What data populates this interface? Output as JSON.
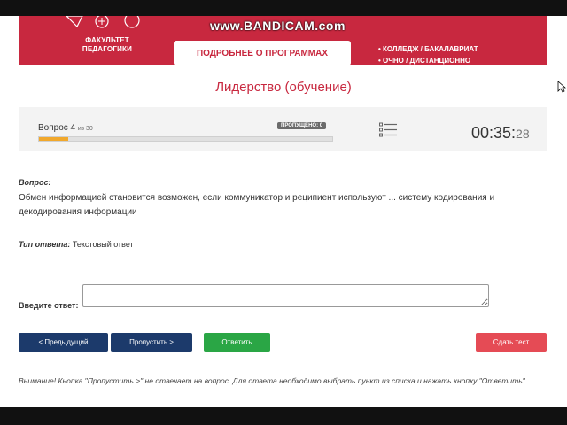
{
  "watermark": "www.BANDICAM.com",
  "banner": {
    "faculty_line1": "ФАКУЛЬТЕТ",
    "faculty_line2": "ПЕДАГОГИКИ",
    "programs_button": "ПОДРОБНЕЕ О ПРОГРАММАХ",
    "feature1": "• КОЛЛЕДЖ / БАКАЛАВРИАТ",
    "feature2": "• ОЧНО / ДИСТАНЦИОННО"
  },
  "page_title": "Лидерство (обучение)",
  "progress": {
    "question_label": "Вопрос 4",
    "of_label": "из 30",
    "skipped_badge": "ПРОПУЩЕНО: 0",
    "fraction": 0.1,
    "colors": {
      "fill": "#f1a82c",
      "track": "#e0e0e0"
    }
  },
  "timer": {
    "main": "00:35:",
    "seconds": "28"
  },
  "question": {
    "label": "Вопрос:",
    "text": "Обмен информацией становится возможен, если коммуникатор и реципиент используют ... систему кодирования и декодирования информации"
  },
  "answer_type": {
    "label": "Тип ответа:",
    "value": "Текстовый ответ"
  },
  "answer": {
    "label": "Введите ответ:",
    "value": ""
  },
  "buttons": {
    "prev": "< Предыдущий",
    "skip": "Пропустить >",
    "answer": "Ответить",
    "submit": "Сдать тест"
  },
  "warning": "Внимание! Кнопка \"Пропустить >\" не отвечает на вопрос. Для ответа необходимо выбрать пункт из списка и нажать кнопку \"Ответить\".",
  "colors": {
    "brand_red": "#c8283f",
    "nav_blue": "#1c3a6b",
    "answer_green": "#2aa645",
    "submit_red": "#e54b55"
  },
  "icons": [
    "list-icon",
    "cursor-icon"
  ]
}
